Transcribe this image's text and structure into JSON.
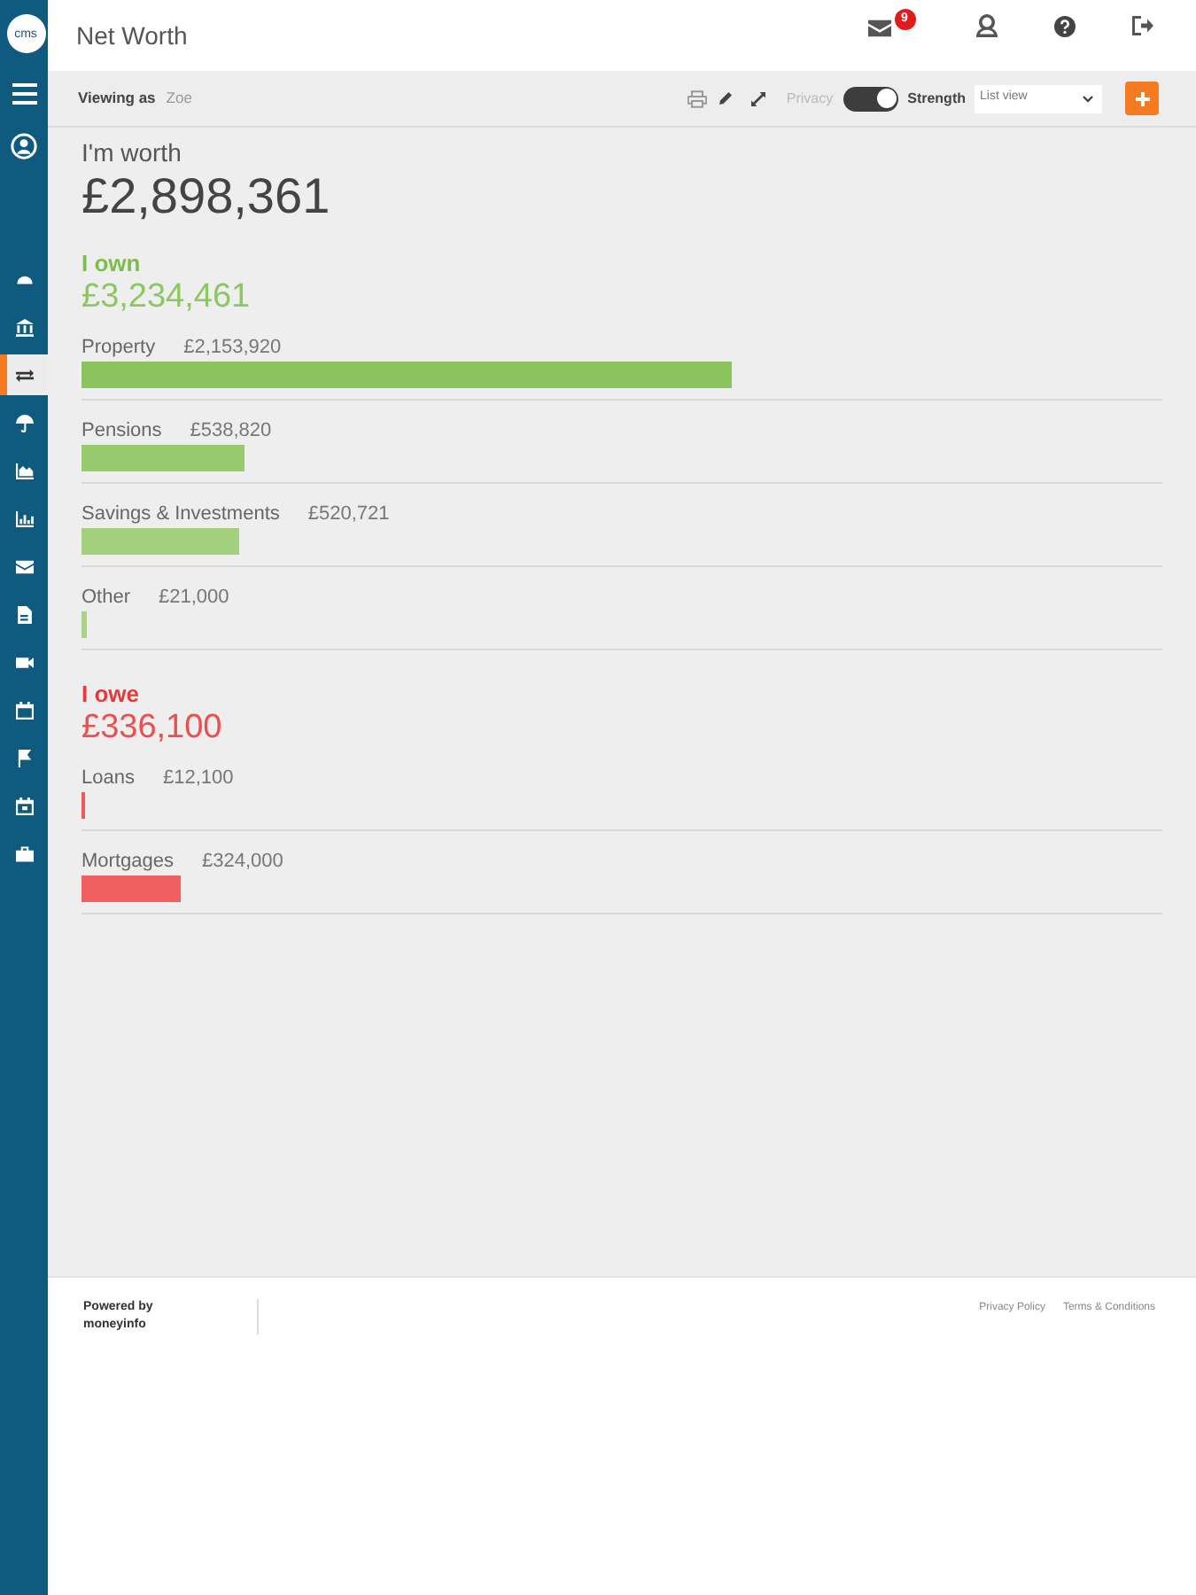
{
  "sidebar": {
    "logo_text": "cms",
    "nav_items": [
      {
        "kind": "gauge",
        "selected": false
      },
      {
        "kind": "bank",
        "selected": false
      },
      {
        "kind": "transfer",
        "selected": true
      },
      {
        "kind": "umbrella",
        "selected": false
      },
      {
        "kind": "area",
        "selected": false
      },
      {
        "kind": "chart",
        "selected": false
      },
      {
        "kind": "mail",
        "selected": false
      },
      {
        "kind": "document",
        "selected": false
      },
      {
        "kind": "video",
        "selected": false
      },
      {
        "kind": "calendar",
        "selected": false
      },
      {
        "kind": "flag",
        "selected": false
      },
      {
        "kind": "planner",
        "selected": false
      },
      {
        "kind": "briefcase",
        "selected": false
      }
    ]
  },
  "header": {
    "title": "Net Worth",
    "unread_badge": "9"
  },
  "toolbar": {
    "viewing_as_label": "Viewing as",
    "viewer": "Zoe",
    "mode_switch": {
      "left_label": "Privacy",
      "right_label": "Strength",
      "on": true
    },
    "view_select": {
      "value": "List view"
    }
  },
  "summary": {
    "label": "I'm worth",
    "amount": "£2,898,361"
  },
  "sections": [
    {
      "kind": "assets",
      "heading": "I own",
      "total": "£3,234,461",
      "items": [
        {
          "label": "Property",
          "amount": "£2,153,920",
          "level": 0.602,
          "color": "#8bc45e"
        },
        {
          "label": "Pensions",
          "amount": "£538,820",
          "level": 0.151,
          "color": "#97ca6c"
        },
        {
          "label": "Savings & Investments",
          "amount": "£520,721",
          "level": 0.146,
          "color": "#a3d07c"
        },
        {
          "label": "Other",
          "amount": "£21,000",
          "level": 0.005,
          "color": "#a9d486"
        }
      ]
    },
    {
      "kind": "liabilities",
      "heading": "I owe",
      "total": "£336,100",
      "items": [
        {
          "label": "Loans",
          "amount": "£12,100",
          "level": 0.0035,
          "color": "#ee5a5a"
        },
        {
          "label": "Mortgages",
          "amount": "£324,000",
          "level": 0.092,
          "color": "#f06060"
        }
      ]
    }
  ],
  "footer": {
    "powered_by": "Powered by",
    "brand": "moneyinfo",
    "links": [
      "Privacy Policy",
      "Terms & Conditions"
    ]
  }
}
